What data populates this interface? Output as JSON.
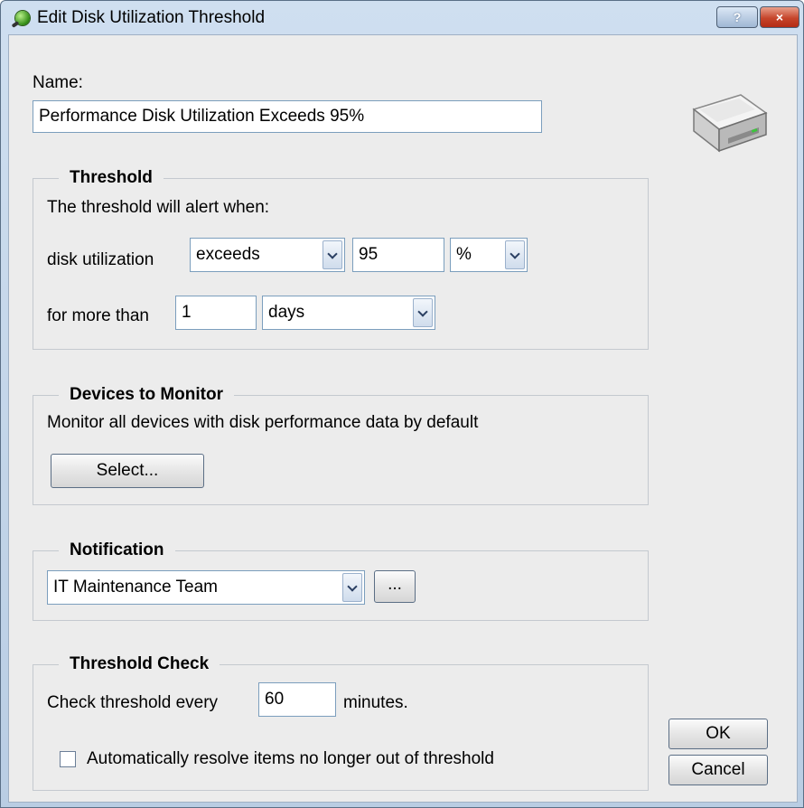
{
  "window": {
    "title": "Edit Disk Utilization Threshold",
    "help_label": "?",
    "close_label": "×"
  },
  "name": {
    "label": "Name:",
    "value": "Performance Disk Utilization Exceeds 95%"
  },
  "threshold": {
    "title": "Threshold",
    "intro": "The threshold will alert when:",
    "metric_label": "disk utilization",
    "operator": "exceeds",
    "value": "95",
    "unit": "%",
    "duration_label": "for more than",
    "duration_value": "1",
    "duration_unit": "days"
  },
  "devices": {
    "title": "Devices to Monitor",
    "description": "Monitor all devices with disk performance data by default",
    "select_label": "Select..."
  },
  "notification": {
    "title": "Notification",
    "recipient": "IT Maintenance Team",
    "browse_label": "..."
  },
  "check": {
    "title": "Threshold Check",
    "prefix": "Check threshold every",
    "interval": "60",
    "suffix": "minutes.",
    "auto_resolve_label": "Automatically resolve items no longer out of threshold",
    "auto_resolve_checked": false
  },
  "buttons": {
    "ok": "OK",
    "cancel": "Cancel"
  },
  "icons": {
    "title": "app-gear-icon",
    "disk": "hard-disk-icon"
  }
}
